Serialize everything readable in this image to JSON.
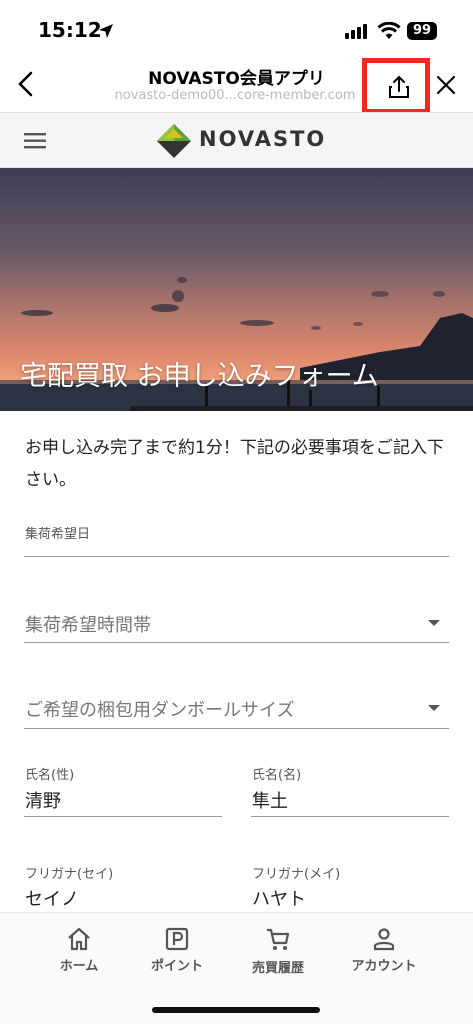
{
  "status_bar": {
    "time": "15:12",
    "battery": "99"
  },
  "browser": {
    "title": "NOVASTO会員アプリ",
    "url": "novasto-demo00...core-member.com"
  },
  "site": {
    "logo_text": "NOVASTO"
  },
  "hero": {
    "title": "宅配買取 お申し込みフォーム"
  },
  "form": {
    "intro": "お申し込み完了まで約1分！下記の必要事項をご記入下さい。",
    "pickup_date_label": "集荷希望日",
    "pickup_time_placeholder": "集荷希望時間帯",
    "box_size_placeholder": "ご希望の梱包用ダンボールサイズ",
    "last_name_label": "氏名(性)",
    "last_name_value": "清野",
    "first_name_label": "氏名(名)",
    "first_name_value": "隼土",
    "last_kana_label": "フリガナ(セイ)",
    "last_kana_value": "セイノ",
    "first_kana_label": "フリガナ(メイ)",
    "first_kana_value": "ハヤト"
  },
  "bottom_nav": {
    "items": [
      {
        "label": "ホーム",
        "icon": "home-icon"
      },
      {
        "label": "ポイント",
        "icon": "parking-p-icon"
      },
      {
        "label": "売買履歴",
        "icon": "cart-icon"
      },
      {
        "label": "アカウント",
        "icon": "person-icon"
      }
    ]
  },
  "colors": {
    "highlight_box": "#f22a1c",
    "logo_green": "#5aa23a",
    "logo_yellow": "#d8c21c",
    "logo_dark": "#333333"
  }
}
